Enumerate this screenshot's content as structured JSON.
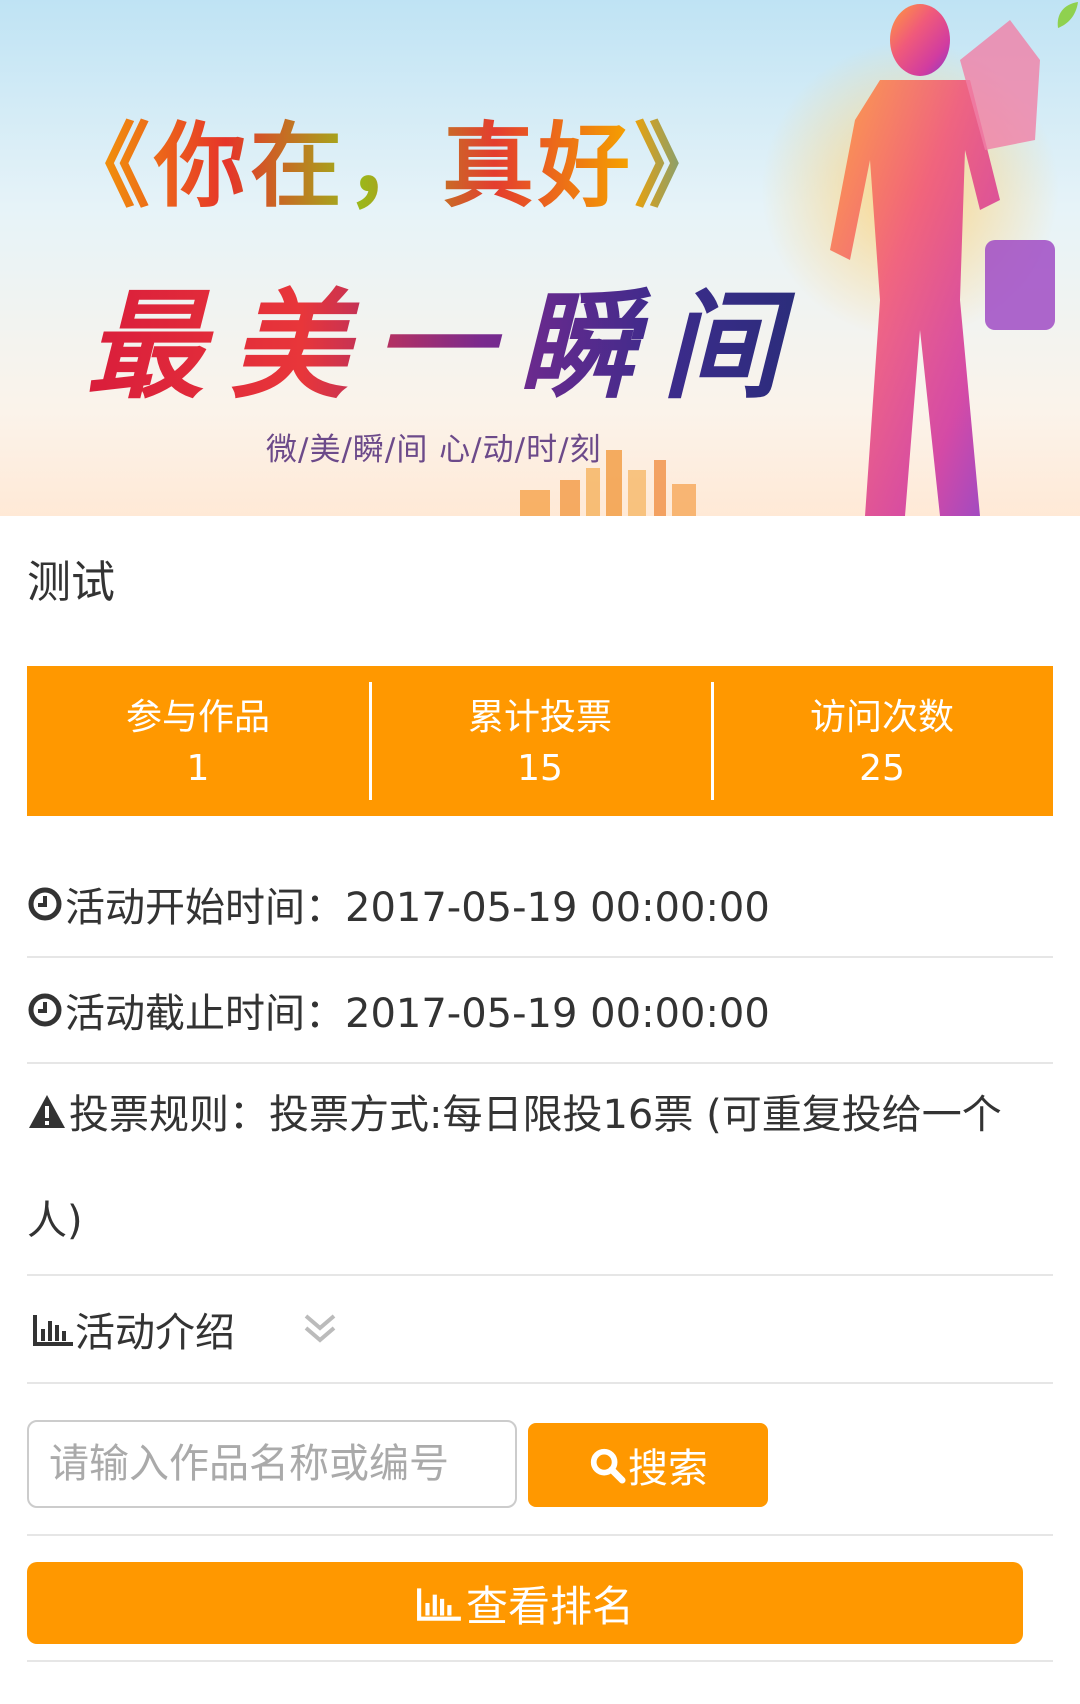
{
  "banner": {
    "title": "《你在，真好》",
    "subtitle": "最美一瞬间",
    "tagline": "微/美/瞬/间  心/动/时/刻"
  },
  "activity": {
    "title": "测试"
  },
  "stats": [
    {
      "label": "参与作品",
      "value": "1"
    },
    {
      "label": "累计投票",
      "value": "15"
    },
    {
      "label": "访问次数",
      "value": "25"
    }
  ],
  "info": {
    "start_time": "活动开始时间：2017-05-19 00:00:00",
    "end_time": "活动截止时间：2017-05-19 00:00:00",
    "rules": "投票规则：投票方式:每日限投16票 (可重复投给一个人)",
    "intro_label": "活动介绍"
  },
  "search": {
    "placeholder": "请输入作品名称或编号",
    "button_label": "搜索"
  },
  "ranking": {
    "button_label": "查看排名"
  },
  "colors": {
    "accent": "#ff9800",
    "divider": "#e6e6e6"
  }
}
